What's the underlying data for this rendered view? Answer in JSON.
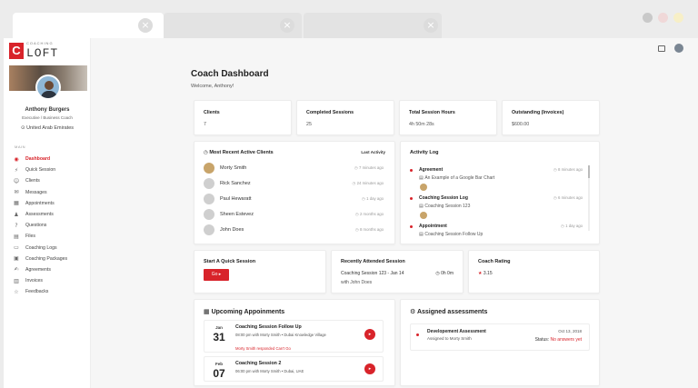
{
  "brand": {
    "line1": "COACHING",
    "line2": "LOFT",
    "letter": "C"
  },
  "user": {
    "name": "Anthony Burgers",
    "role": "Executive / Business Coach",
    "location": "United Arab Emirates"
  },
  "sidebar": {
    "section_label": "MAIN",
    "items": [
      {
        "label": "Dashboard",
        "icon": "dashboard-icon",
        "glyph": "◉",
        "active": true
      },
      {
        "label": "Quick Session",
        "icon": "bolt-icon",
        "glyph": "⚡",
        "active": false
      },
      {
        "label": "Clients",
        "icon": "clients-icon",
        "glyph": "☺",
        "active": false
      },
      {
        "label": "Messages",
        "icon": "messages-icon",
        "glyph": "✉",
        "active": false
      },
      {
        "label": "Appointments",
        "icon": "appointments-icon",
        "glyph": "▦",
        "active": false
      },
      {
        "label": "Assessments",
        "icon": "assessments-icon",
        "glyph": "♟",
        "active": false
      },
      {
        "label": "Questions",
        "icon": "questions-icon",
        "glyph": "?",
        "active": false
      },
      {
        "label": "Files",
        "icon": "files-icon",
        "glyph": "▤",
        "active": false
      },
      {
        "label": "Coaching Logs",
        "icon": "logs-icon",
        "glyph": "▭",
        "active": false
      },
      {
        "label": "Coaching Packages",
        "icon": "packages-icon",
        "glyph": "▣",
        "active": false
      },
      {
        "label": "Agreements",
        "icon": "agreements-icon",
        "glyph": "✍",
        "active": false
      },
      {
        "label": "Invoices",
        "icon": "invoices-icon",
        "glyph": "▥",
        "active": false
      },
      {
        "label": "Feedbacks",
        "icon": "feedbacks-icon",
        "glyph": "☆",
        "active": false
      }
    ]
  },
  "header": {
    "title": "Coach Dashboard",
    "welcome": "Welcome, Anthony!"
  },
  "stats": [
    {
      "label": "Clients",
      "value": "7"
    },
    {
      "label": "Completed Sessions",
      "value": "25"
    },
    {
      "label": "Total Session Hours",
      "value": "4h 50m 28s"
    },
    {
      "label": "Outstanding (Invoices)",
      "value": "$600.00"
    }
  ],
  "clients_card": {
    "title": "Most Recent Active Clients",
    "action": "Last Activity",
    "rows": [
      {
        "name": "Morty Smith",
        "time": "7 minutes ago",
        "photo": true
      },
      {
        "name": "Rick Sanchez",
        "time": "24 minutes ago",
        "photo": false
      },
      {
        "name": "Paul Hewaratt",
        "time": "1 day ago",
        "photo": false
      },
      {
        "name": "Sheen Estevez",
        "time": "2 months ago",
        "photo": false
      },
      {
        "name": "John Does",
        "time": "8 months ago",
        "photo": false
      }
    ]
  },
  "activity": {
    "title": "Activity Log",
    "items": [
      {
        "head": "Agreement",
        "sub": "An Example of a Google Bar Chart",
        "time": "8 minutes ago",
        "avatar": true
      },
      {
        "head": "Coaching Session Log",
        "sub": "Coaching Session 123",
        "time": "6 minutes ago",
        "avatar": true
      },
      {
        "head": "Appointment",
        "sub": "Coaching Session Follow Up",
        "time": "1 day ago",
        "avatar": false
      }
    ]
  },
  "quick": {
    "title": "Start A Quick Session",
    "button": "Go ▸"
  },
  "recent": {
    "title": "Recently Attended Session",
    "session": "Coaching Session 123 - Jan 14",
    "with": "with John Does",
    "duration": "0h 0m"
  },
  "rating": {
    "title": "Coach Rating",
    "star": "★",
    "value": "3.15"
  },
  "upcoming": {
    "title": "Upcoming Appoinments",
    "items": [
      {
        "month": "Jan",
        "day": "31",
        "title": "Coaching Session Follow Up",
        "detail": "08:00 pm with Morty Smith • Dubai Knowledge Village",
        "note": "Morty Smith responded Can't Go"
      },
      {
        "month": "Feb",
        "day": "07",
        "title": "Coaching Session 2",
        "detail": "06:00 pm with Morty Smith • Dubai, UAE",
        "note": ""
      }
    ]
  },
  "assessments": {
    "title": "Assigned assessments",
    "item": {
      "title": "Developement Assessment",
      "sub": "Assigned to Morty Smith",
      "date": "Oct 13, 2018",
      "status_label": "Status:",
      "status_value": "No answers yet"
    }
  },
  "colors": {
    "accent": "#d8232a",
    "win_dots": [
      "#c9c9c9",
      "#f0d8d8",
      "#f7efc7"
    ]
  },
  "icons": {
    "tab_close": "×",
    "arrow": "▸"
  }
}
